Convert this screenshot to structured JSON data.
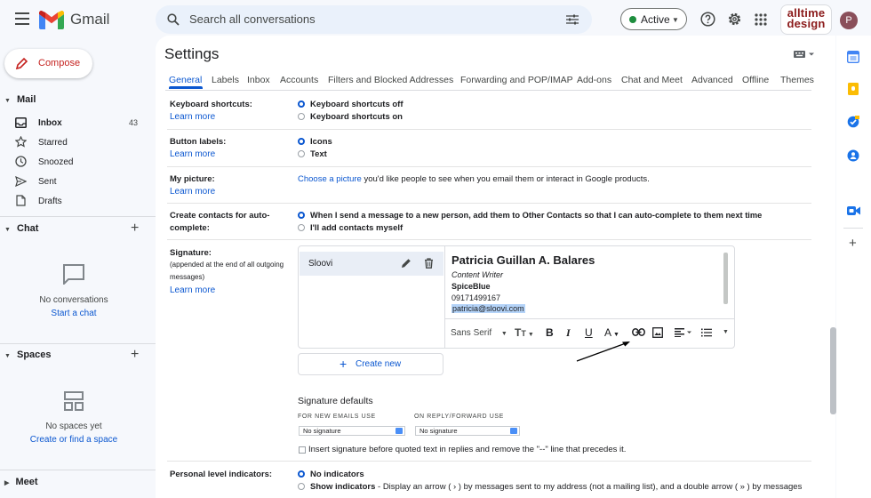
{
  "app": {
    "name": "Gmail"
  },
  "search": {
    "placeholder": "Search all conversations"
  },
  "status": {
    "label": "Active",
    "color": "#1e8e3e"
  },
  "brand": {
    "line1": "alltime",
    "line2": "design"
  },
  "account": {
    "avatar_letter": "P"
  },
  "compose": {
    "label": "Compose"
  },
  "nav": {
    "mail_label": "Mail",
    "items": [
      {
        "label": "Inbox",
        "count": "43",
        "icon": "inbox-icon"
      },
      {
        "label": "Starred",
        "icon": "star-icon"
      },
      {
        "label": "Snoozed",
        "icon": "clock-icon"
      },
      {
        "label": "Sent",
        "icon": "send-icon"
      },
      {
        "label": "Drafts",
        "icon": "draft-icon"
      }
    ],
    "chat": {
      "label": "Chat",
      "empty": "No conversations",
      "action": "Start a chat"
    },
    "spaces": {
      "label": "Spaces",
      "empty": "No spaces yet",
      "action": "Create or find a space"
    },
    "meet": {
      "label": "Meet"
    }
  },
  "settings": {
    "title": "Settings",
    "tabs": [
      "General",
      "Labels",
      "Inbox",
      "Accounts",
      "Filters and Blocked Addresses",
      "Forwarding and POP/IMAP",
      "Add-ons",
      "Chat and Meet",
      "Advanced",
      "Offline",
      "Themes"
    ],
    "learn_more": "Learn more",
    "keyboard": {
      "label": "Keyboard shortcuts:",
      "off": "Keyboard shortcuts off",
      "on": "Keyboard shortcuts on"
    },
    "button_labels": {
      "label": "Button labels:",
      "icons": "Icons",
      "text": "Text"
    },
    "picture": {
      "label": "My picture:",
      "link": "Choose a picture",
      "rest": " you'd like people to see when you email them or interact in Google products."
    },
    "contacts": {
      "label1": "Create contacts for auto-",
      "label2": "complete:",
      "opt1": "When I send a message to a new person, add them to Other Contacts so that I can auto-complete to them next time",
      "opt2": "I'll add contacts myself"
    },
    "signature": {
      "label": "Signature:",
      "note1": "(appended at the end of all outgoing",
      "note2": "messages)",
      "item_name": "Sloovi",
      "name": "Patricia Guillan A. Balares",
      "role": "Content Writer",
      "company": "SpiceBlue",
      "phone": "09171499167",
      "email": "patricia@sloovi.com",
      "font": "Sans Serif",
      "create_new": "Create new"
    },
    "sig_defaults": {
      "title": "Signature defaults",
      "new_label": "FOR NEW EMAILS USE",
      "reply_label": "ON REPLY/FORWARD USE",
      "new_value": "No signature",
      "reply_value": "No signature",
      "insert_text": "Insert signature before quoted text in replies and remove the \"--\" line that precedes it."
    },
    "personal": {
      "label": "Personal level indicators:",
      "opt1": "No indicators",
      "opt2_bold": "Show indicators",
      "opt2_rest": " - Display an arrow ( › ) by messages sent to my address (not a mailing list), and a double arrow ( » ) by messages"
    }
  },
  "colors": {
    "accent": "#0b57d0",
    "compose_red": "#c5221f"
  }
}
